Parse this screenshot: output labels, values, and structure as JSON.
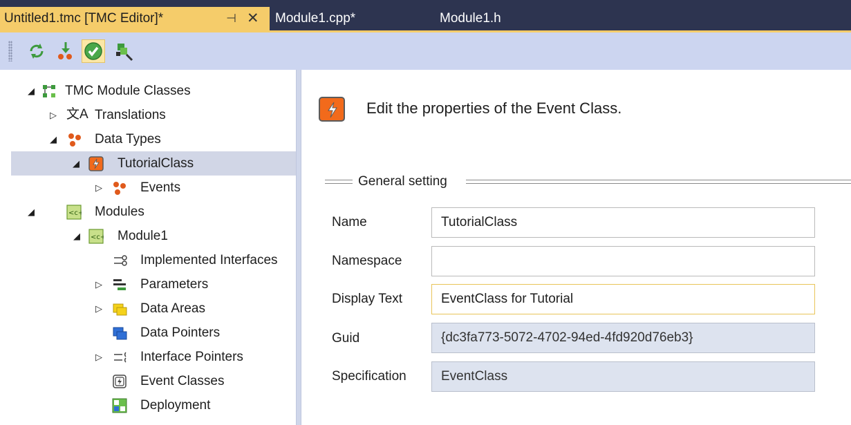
{
  "tabs": [
    {
      "label": "Untitled1.tmc [TMC Editor]*",
      "active": true
    },
    {
      "label": "Module1.cpp*",
      "active": false
    },
    {
      "label": "Module1.h",
      "active": false
    }
  ],
  "tab_glyphs": {
    "pin": "⊣",
    "close": "✕"
  },
  "toolbar": {
    "buttons": [
      "refresh-icon",
      "import-icon",
      "check-icon",
      "deploy-icon"
    ]
  },
  "tree": {
    "root": "TMC Module Classes",
    "translations": "Translations",
    "data_types": "Data Types",
    "tutorial_class": "TutorialClass",
    "events": "Events",
    "modules": "Modules",
    "module1": "Module1",
    "implemented_interfaces": "Implemented Interfaces",
    "parameters": "Parameters",
    "data_areas": "Data Areas",
    "data_pointers": "Data Pointers",
    "interface_pointers": "Interface Pointers",
    "event_classes": "Event Classes",
    "deployment": "Deployment"
  },
  "panel": {
    "heading": "Edit the properties of the Event Class.",
    "group_title": "General setting",
    "fields": {
      "name": {
        "label": "Name",
        "value": "TutorialClass"
      },
      "namespace": {
        "label": "Namespace",
        "value": ""
      },
      "display_text": {
        "label": "Display Text",
        "value": "EventClass for Tutorial"
      },
      "guid": {
        "label": "Guid",
        "value": "{dc3fa773-5072-4702-94ed-4fd920d76eb3}"
      },
      "specification": {
        "label": "Specification",
        "value": "EventClass"
      }
    }
  },
  "colors": {
    "tab_active": "#f5cc6a",
    "tabstrip_bg": "#2d3450",
    "toolbar_bg": "#ccd5f0",
    "selection_bg": "#d1d6e6",
    "event_icon": "#f26a1b",
    "readonly_field_bg": "#dde3ef"
  }
}
